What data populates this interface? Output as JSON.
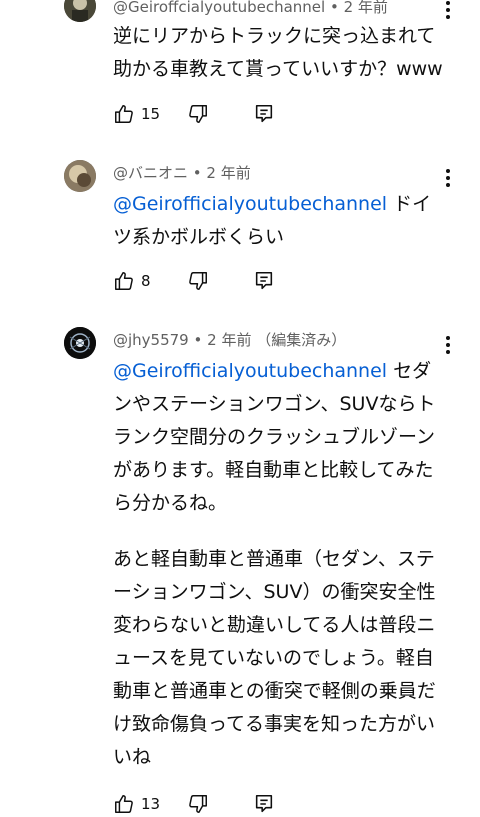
{
  "comments": [
    {
      "author": "@Geiroffcialyoutubechannel",
      "time": "2 年前",
      "edited": "",
      "mention": "",
      "text": "逆にリアからトラックに突っ込まれて助かる車教えて貰っていいすか？www",
      "likes": "15"
    },
    {
      "author": "@バニオニ",
      "time": "2 年前",
      "edited": "",
      "mention": "@Geirofficialyoutubechannel",
      "text": "ドイツ系かボルボくらい",
      "likes": "8"
    },
    {
      "author": "@jhy5579",
      "time": "2 年前",
      "edited": "（編集済み）",
      "mention": "@Geirofficialyoutubechannel",
      "text": "セダンやステーションワゴン、SUVならトランク空間分のクラッシュブルゾーンがあります。軽自動車と比較してみたら分かるね。",
      "text2": "あと軽自動車と普通車（セダン、ステーションワゴン、SUV）の衝突安全性変わらないと勘違いしてる人は普段ニュースを見ていないのでしょう。軽自動車と普通車との衝突で軽側の乗員だけ致命傷負ってる事実を知った方がいいね",
      "likes": "13"
    }
  ],
  "colors": {
    "text": "#0f0f0f",
    "meta": "#606060",
    "link": "#065fd4",
    "background": "#ffffff"
  },
  "icons": {
    "like": "thumb-up-icon",
    "dislike": "thumb-down-icon",
    "reply": "reply-icon",
    "more": "more-vert-icon"
  }
}
